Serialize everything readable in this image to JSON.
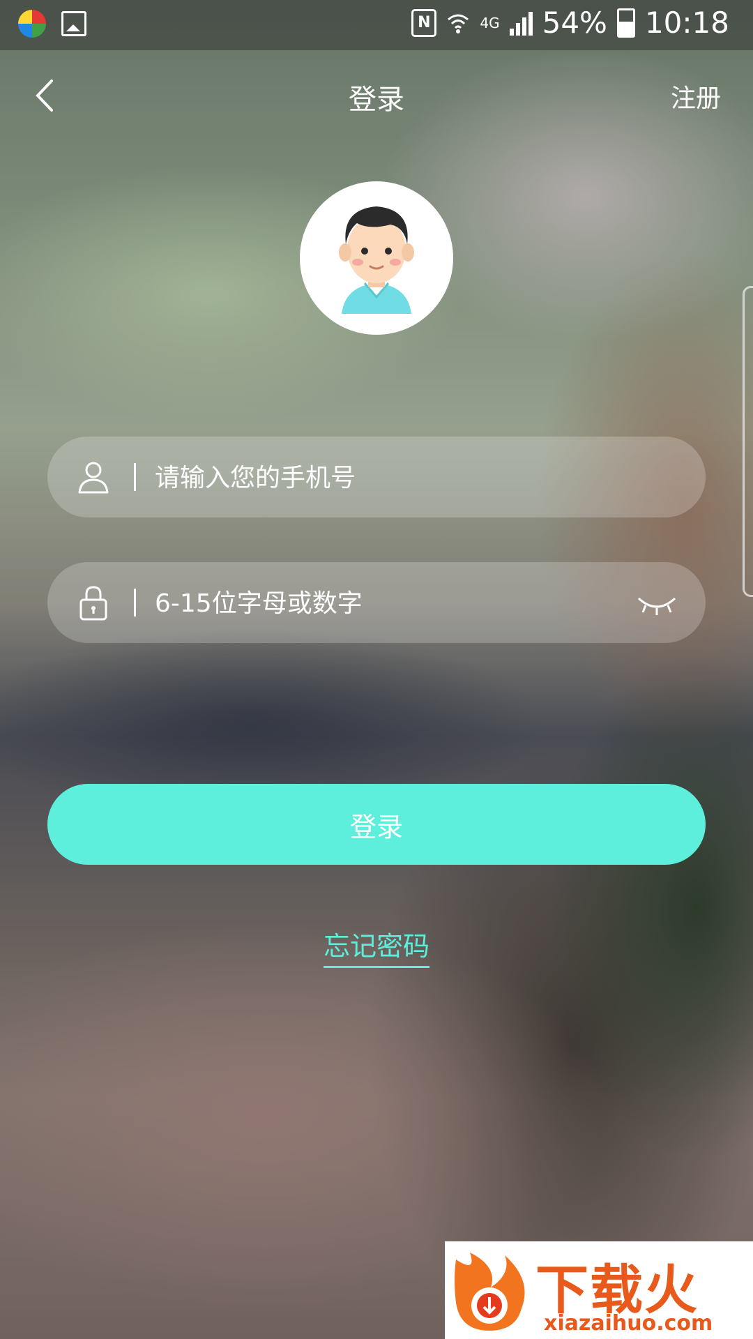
{
  "status_bar": {
    "network": "4G",
    "battery": "54%",
    "time": "10:18",
    "icons": [
      "app-icon",
      "gallery-icon",
      "nfc-icon",
      "wifi-icon",
      "signal-icon",
      "battery-icon"
    ]
  },
  "header": {
    "title": "登录",
    "register": "注册",
    "back_icon": "chevron-left-icon"
  },
  "form": {
    "phone_placeholder": "请输入您的手机号",
    "password_placeholder": "6-15位字母或数字",
    "login_label": "登录",
    "forgot_label": "忘记密码"
  },
  "watermark": {
    "title": "下载火",
    "url": "xiazaihuo.com"
  },
  "colors": {
    "accent": "#5eefdc",
    "input_bg": "rgba(255,255,255,0.22)"
  }
}
